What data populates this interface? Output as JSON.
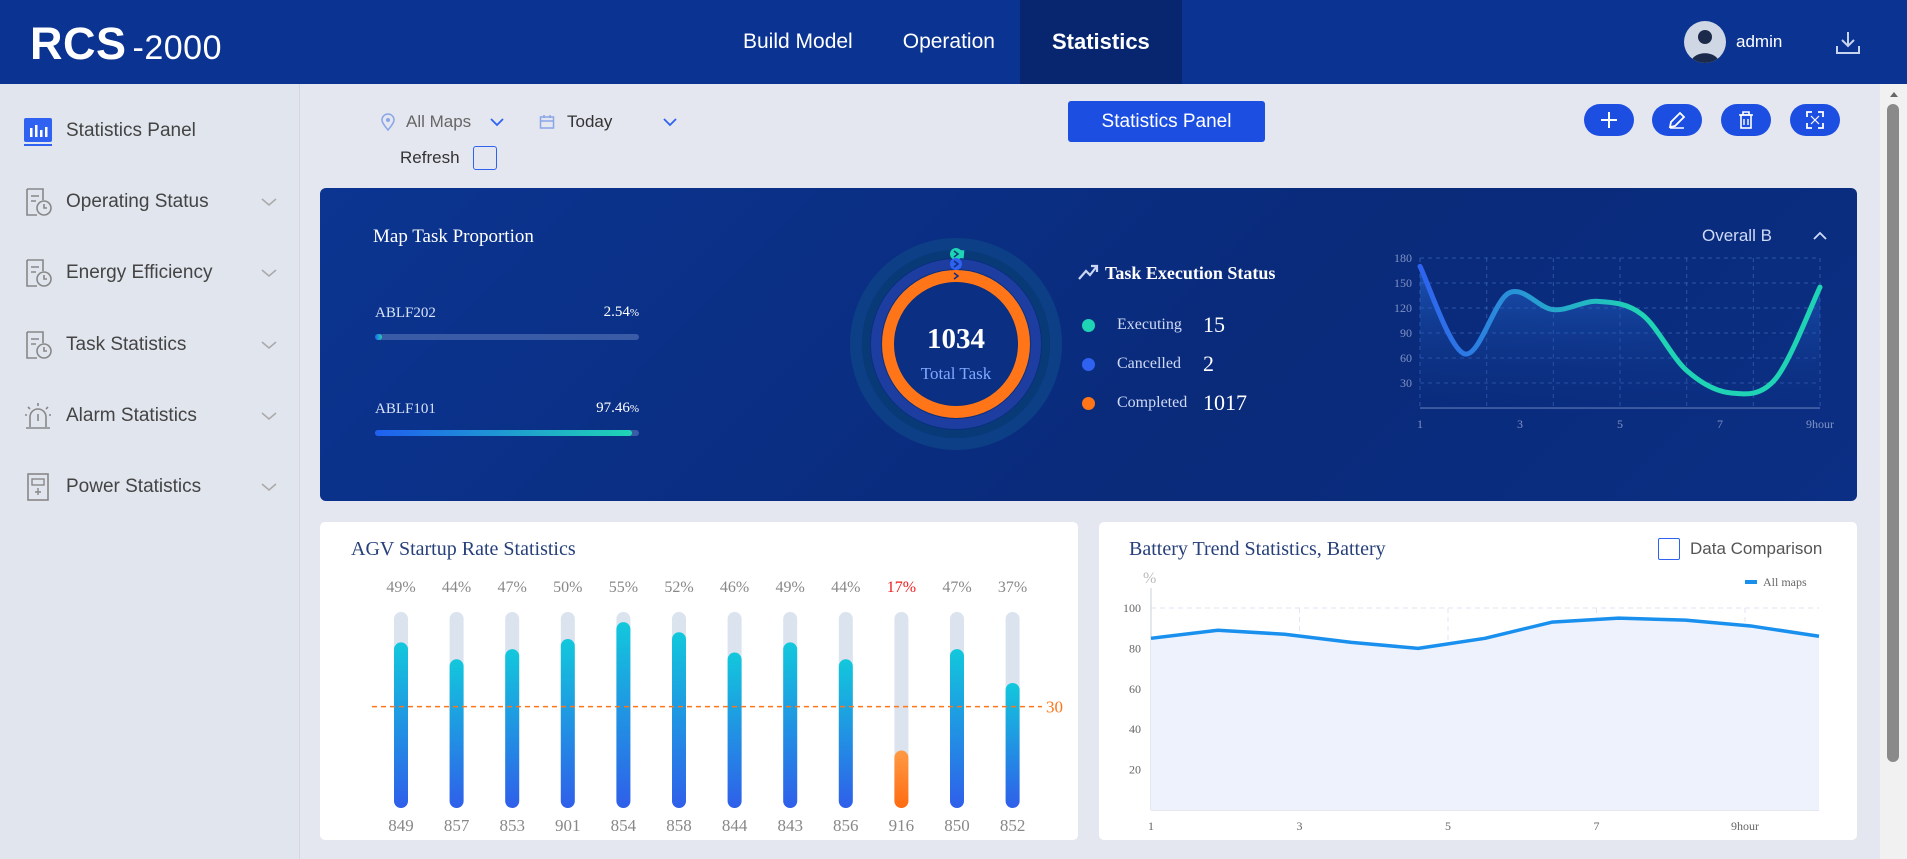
{
  "header": {
    "logo_main": "RCS",
    "logo_suffix": "-2000",
    "nav": [
      {
        "label": "Build Model"
      },
      {
        "label": "Operation"
      },
      {
        "label": "Statistics",
        "active": true
      }
    ],
    "user_name": "admin"
  },
  "sidebar": {
    "items": [
      {
        "label": "Statistics Panel",
        "icon": "bar-chart-icon",
        "active": true
      },
      {
        "label": "Operating Status",
        "icon": "clock-doc-icon"
      },
      {
        "label": "Energy Efficiency",
        "icon": "clock-doc-icon"
      },
      {
        "label": "Task Statistics",
        "icon": "clock-doc-icon"
      },
      {
        "label": "Alarm Statistics",
        "icon": "alarm-icon"
      },
      {
        "label": "Power Statistics",
        "icon": "power-doc-icon"
      }
    ]
  },
  "toolbar": {
    "map_filter": "All Maps",
    "date_filter": "Today",
    "refresh_label": "Refresh",
    "panel_button": "Statistics Panel"
  },
  "map_task": {
    "title": "Map Task Proportion",
    "items": [
      {
        "name": "ABLF202",
        "value": "2.54",
        "unit": "%",
        "fraction": 0.0254
      },
      {
        "name": "ABLF101",
        "value": "97.46",
        "unit": "%",
        "fraction": 0.9746
      }
    ]
  },
  "total_task": {
    "value": "1034",
    "label": "Total Task"
  },
  "task_status": {
    "title": "Task Execution Status",
    "items": [
      {
        "label": "Executing",
        "value": "15",
        "color": "#1fd4b4"
      },
      {
        "label": "Cancelled",
        "value": "2",
        "color": "#2f62f0"
      },
      {
        "label": "Completed",
        "value": "1017",
        "color": "#ff7518"
      }
    ]
  },
  "overall": {
    "label": "Overall B"
  },
  "colors": {
    "brand": "#0b3391",
    "accent": "#1d4ee2",
    "orange": "#ff7518",
    "teal": "#1fd4b4"
  },
  "chart_data": [
    {
      "type": "area",
      "xticks": [
        "1",
        "3",
        "5",
        "7",
        "9hour"
      ],
      "yticks": [
        "180",
        "150",
        "120",
        "90",
        "60",
        "30"
      ],
      "ylim": [
        0,
        180
      ],
      "x": [
        1,
        2,
        3,
        4,
        5,
        6,
        7,
        8,
        9,
        10
      ],
      "values": [
        170,
        65,
        138,
        118,
        128,
        112,
        45,
        18,
        35,
        145
      ]
    },
    {
      "type": "bar",
      "title": "AGV Startup Rate Statistics",
      "categories": [
        "849",
        "857",
        "853",
        "901",
        "854",
        "858",
        "844",
        "843",
        "856",
        "916",
        "850",
        "852"
      ],
      "labels": [
        "49%",
        "44%",
        "47%",
        "50%",
        "55%",
        "52%",
        "46%",
        "49%",
        "44%",
        "17%",
        "47%",
        "37%"
      ],
      "values": [
        49,
        44,
        47,
        50,
        55,
        52,
        46,
        49,
        44,
        17,
        47,
        37
      ],
      "threshold": 30,
      "threshold_label": "30",
      "ylim": [
        0,
        100
      ]
    },
    {
      "type": "line",
      "title": "Battery Trend Statistics, Battery",
      "ylabel": "%",
      "yticks": [
        "100",
        "80",
        "60",
        "40",
        "20"
      ],
      "xticks": [
        "1",
        "3",
        "5",
        "7",
        "9hour"
      ],
      "ylim": [
        0,
        100
      ],
      "x": [
        1,
        2,
        3,
        4,
        5,
        6,
        7,
        8,
        9,
        10,
        11
      ],
      "series": [
        {
          "name": "All maps",
          "values": [
            85,
            89,
            87,
            83,
            80,
            85,
            93,
            95,
            94,
            91,
            86
          ]
        }
      ],
      "comparison_label": "Data Comparison"
    }
  ]
}
